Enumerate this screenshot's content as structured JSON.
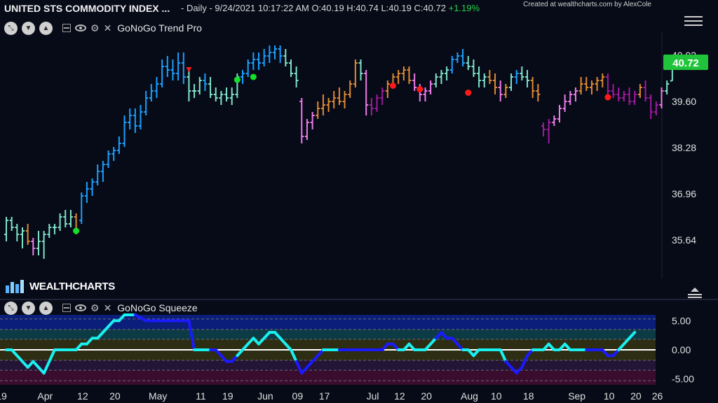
{
  "header": {
    "title": "UNITED STS COMMODITY INDEX ...",
    "info": "- Daily - 9/24/2021 10:17:22 AM O:40.19 H:40.74 L:40.19 C:40.72",
    "change": "+1.19%",
    "credit": "Created at wealthcharts.com by AlexCole"
  },
  "price_panel": {
    "indicator_label": "GoNoGo Trend Pro"
  },
  "squeeze_panel": {
    "indicator_label": "GoNoGo Squeeze"
  },
  "logo": {
    "text": "WEALTHCHARTS"
  },
  "colors": {
    "background": "#070b18",
    "go_strong": "#1aa0ff",
    "go_weak": "#7fe3c8",
    "nogo_weak": "#ee7ce8",
    "nogo_strong": "#a01a9e",
    "amber": "#e08a32",
    "dot_green": "#14e02a",
    "dot_red": "#ff1a1a",
    "squeeze_cyan": "#19f0f0",
    "squeeze_blue": "#1a1aff",
    "price_badge": "#20c43a"
  },
  "chart_data": [
    {
      "type": "bar",
      "title": "UNITED STS COMMODITY INDEX ...",
      "last_price_label": "40.72",
      "y_ticks": [
        35.64,
        36.96,
        38.28,
        39.6,
        40.92
      ],
      "y_tick_labels": [
        "35.64",
        "36.96",
        "38.28",
        "39.60",
        "40.92"
      ],
      "x_ticks": [
        {
          "i": -7,
          "label": "19"
        },
        {
          "i": 2,
          "label": "Apr"
        },
        {
          "i": 9,
          "label": "12"
        },
        {
          "i": 15,
          "label": "20"
        },
        {
          "i": 23,
          "label": "May"
        },
        {
          "i": 31,
          "label": "11"
        },
        {
          "i": 36,
          "label": "19"
        },
        {
          "i": 43,
          "label": "Jun"
        },
        {
          "i": 49,
          "label": "09"
        },
        {
          "i": 54,
          "label": "17"
        },
        {
          "i": 63,
          "label": "Jul"
        },
        {
          "i": 68,
          "label": "12"
        },
        {
          "i": 73,
          "label": "20"
        },
        {
          "i": 81,
          "label": "Aug"
        },
        {
          "i": 86,
          "label": "10"
        },
        {
          "i": 92,
          "label": "18"
        },
        {
          "i": 101,
          "label": "Sep"
        },
        {
          "i": 107,
          "label": "10"
        },
        {
          "i": 112,
          "label": "20"
        },
        {
          "i": 116,
          "label": "26"
        }
      ],
      "ylim": [
        34.6,
        41.6
      ],
      "ohlc": [
        [
          35.8,
          36.3,
          35.6,
          36.2,
          "gw"
        ],
        [
          36.2,
          36.3,
          35.9,
          36.0,
          "gw"
        ],
        [
          36.0,
          36.1,
          35.6,
          35.8,
          "gw"
        ],
        [
          35.8,
          36.0,
          35.4,
          35.9,
          "gw"
        ],
        [
          35.9,
          36.1,
          35.5,
          35.6,
          "am"
        ],
        [
          35.6,
          35.7,
          35.2,
          35.4,
          "nw"
        ],
        [
          35.4,
          35.9,
          35.2,
          35.6,
          "gw"
        ],
        [
          35.6,
          35.9,
          35.1,
          35.8,
          "gw"
        ],
        [
          35.8,
          36.1,
          35.7,
          36.0,
          "gw"
        ],
        [
          36.0,
          36.1,
          35.8,
          36.0,
          "gw"
        ],
        [
          36.0,
          36.4,
          35.9,
          36.3,
          "gw"
        ],
        [
          36.3,
          36.5,
          36.0,
          36.1,
          "gw"
        ],
        [
          36.1,
          36.5,
          36.0,
          36.3,
          "gw"
        ],
        [
          36.3,
          36.4,
          35.8,
          35.9,
          "am"
        ],
        [
          36.2,
          37.0,
          36.1,
          36.9,
          "gs"
        ],
        [
          36.9,
          37.3,
          36.7,
          37.1,
          "gs"
        ],
        [
          37.1,
          37.4,
          36.9,
          37.3,
          "gs"
        ],
        [
          37.3,
          37.8,
          37.2,
          37.6,
          "gs"
        ],
        [
          37.6,
          37.9,
          37.3,
          37.8,
          "gs"
        ],
        [
          37.8,
          38.2,
          37.7,
          38.1,
          "gs"
        ],
        [
          38.1,
          38.3,
          37.9,
          38.2,
          "gs"
        ],
        [
          38.2,
          38.6,
          38.1,
          38.4,
          "gs"
        ],
        [
          38.4,
          39.2,
          38.3,
          39.0,
          "gs"
        ],
        [
          39.0,
          39.4,
          38.8,
          39.2,
          "gs"
        ],
        [
          39.2,
          39.4,
          38.7,
          38.9,
          "gs"
        ],
        [
          38.9,
          39.5,
          38.8,
          39.3,
          "gs"
        ],
        [
          39.3,
          39.9,
          39.2,
          39.7,
          "gs"
        ],
        [
          39.7,
          40.1,
          39.6,
          39.9,
          "gs"
        ],
        [
          39.9,
          40.3,
          39.7,
          40.1,
          "gs"
        ],
        [
          40.1,
          40.8,
          40.0,
          40.6,
          "gs"
        ],
        [
          40.6,
          40.9,
          40.3,
          40.5,
          "gs"
        ],
        [
          40.5,
          40.8,
          40.2,
          40.4,
          "gs"
        ],
        [
          40.4,
          41.0,
          40.2,
          40.7,
          "gs"
        ],
        [
          40.7,
          41.0,
          40.1,
          40.3,
          "gs"
        ],
        [
          40.3,
          40.5,
          39.6,
          39.9,
          "gw"
        ],
        [
          39.9,
          40.1,
          39.7,
          39.9,
          "gw"
        ],
        [
          39.9,
          40.3,
          39.8,
          40.2,
          "gw"
        ],
        [
          40.2,
          40.4,
          39.9,
          40.1,
          "gs"
        ],
        [
          40.1,
          40.3,
          39.7,
          39.8,
          "gw"
        ],
        [
          39.8,
          40.0,
          39.6,
          39.7,
          "gw"
        ],
        [
          39.7,
          39.9,
          39.5,
          39.8,
          "gw"
        ],
        [
          39.8,
          40.0,
          39.6,
          39.7,
          "gw"
        ],
        [
          39.7,
          40.0,
          39.5,
          39.8,
          "gw"
        ],
        [
          39.8,
          40.4,
          39.7,
          40.3,
          "gw"
        ],
        [
          40.3,
          40.5,
          40.1,
          40.4,
          "gs"
        ],
        [
          40.4,
          40.8,
          40.3,
          40.7,
          "gs"
        ],
        [
          40.7,
          41.0,
          40.5,
          40.8,
          "gs"
        ],
        [
          40.8,
          41.0,
          40.5,
          40.7,
          "gs"
        ],
        [
          40.7,
          41.1,
          40.6,
          40.9,
          "gs"
        ],
        [
          40.9,
          41.2,
          40.7,
          41.0,
          "gs"
        ],
        [
          41.0,
          41.2,
          40.8,
          41.1,
          "gs"
        ],
        [
          41.1,
          41.2,
          40.7,
          40.9,
          "gs"
        ],
        [
          40.9,
          41.1,
          40.6,
          40.7,
          "gw"
        ],
        [
          40.7,
          40.8,
          40.3,
          40.4,
          "gw"
        ],
        [
          40.4,
          40.6,
          40.0,
          40.2,
          "gw"
        ],
        [
          39.6,
          39.7,
          38.4,
          38.6,
          "nw"
        ],
        [
          38.6,
          39.1,
          38.5,
          39.0,
          "nw"
        ],
        [
          39.0,
          39.3,
          38.8,
          39.2,
          "nw"
        ],
        [
          39.2,
          39.6,
          39.1,
          39.4,
          "am"
        ],
        [
          39.4,
          39.8,
          39.2,
          39.5,
          "am"
        ],
        [
          39.5,
          39.7,
          39.3,
          39.6,
          "am"
        ],
        [
          39.6,
          39.9,
          39.4,
          39.7,
          "am"
        ],
        [
          39.7,
          40.0,
          39.5,
          39.6,
          "am"
        ],
        [
          39.6,
          39.9,
          39.4,
          39.8,
          "am"
        ],
        [
          39.8,
          40.2,
          39.7,
          40.1,
          "am"
        ],
        [
          40.1,
          40.8,
          40.0,
          40.7,
          "am"
        ],
        [
          40.7,
          40.8,
          40.2,
          40.4,
          "gw"
        ],
        [
          40.4,
          40.5,
          39.2,
          39.5,
          "nw"
        ],
        [
          39.5,
          39.7,
          39.2,
          39.4,
          "ns"
        ],
        [
          39.4,
          39.8,
          39.3,
          39.7,
          "ns"
        ],
        [
          39.7,
          40.0,
          39.5,
          39.9,
          "ns"
        ],
        [
          39.9,
          40.2,
          39.7,
          40.1,
          "am"
        ],
        [
          40.1,
          40.4,
          40.0,
          40.3,
          "am"
        ],
        [
          40.3,
          40.5,
          40.1,
          40.4,
          "am"
        ],
        [
          40.4,
          40.6,
          40.2,
          40.5,
          "am"
        ],
        [
          40.5,
          40.6,
          40.1,
          40.2,
          "am"
        ],
        [
          40.2,
          40.4,
          39.9,
          40.0,
          "nw"
        ],
        [
          40.0,
          40.1,
          39.6,
          39.8,
          "nw"
        ],
        [
          39.8,
          40.0,
          39.6,
          39.9,
          "nw"
        ],
        [
          39.9,
          40.2,
          39.8,
          40.1,
          "nw"
        ],
        [
          40.1,
          40.4,
          40.0,
          40.3,
          "gw"
        ],
        [
          40.3,
          40.5,
          40.1,
          40.4,
          "gw"
        ],
        [
          40.4,
          40.6,
          40.2,
          40.5,
          "gw"
        ],
        [
          40.5,
          40.9,
          40.4,
          40.8,
          "gs"
        ],
        [
          40.8,
          41.0,
          40.7,
          40.9,
          "gs"
        ],
        [
          40.9,
          41.1,
          40.6,
          40.7,
          "gs"
        ],
        [
          40.7,
          40.9,
          40.5,
          40.6,
          "gw"
        ],
        [
          40.6,
          40.8,
          40.3,
          40.4,
          "gw"
        ],
        [
          40.4,
          40.6,
          40.0,
          40.2,
          "gw"
        ],
        [
          40.2,
          40.4,
          40.0,
          40.3,
          "gw"
        ],
        [
          40.3,
          40.5,
          40.1,
          40.2,
          "am"
        ],
        [
          40.2,
          40.4,
          39.8,
          40.0,
          "am"
        ],
        [
          40.0,
          40.2,
          39.6,
          39.8,
          "nw"
        ],
        [
          39.8,
          40.1,
          39.7,
          40.0,
          "am"
        ],
        [
          40.0,
          40.4,
          39.9,
          40.3,
          "gw"
        ],
        [
          40.3,
          40.5,
          40.1,
          40.4,
          "gs"
        ],
        [
          40.4,
          40.6,
          40.2,
          40.3,
          "gw"
        ],
        [
          40.3,
          40.5,
          40.0,
          40.2,
          "gw"
        ],
        [
          40.2,
          40.3,
          39.7,
          39.9,
          "am"
        ],
        [
          39.9,
          40.1,
          39.6,
          39.8,
          "am"
        ],
        [
          38.9,
          39.0,
          38.6,
          38.8,
          "ns"
        ],
        [
          38.8,
          39.1,
          38.4,
          39.0,
          "ns"
        ],
        [
          39.0,
          39.2,
          38.9,
          39.1,
          "nw"
        ],
        [
          39.1,
          39.5,
          39.0,
          39.4,
          "nw"
        ],
        [
          39.4,
          39.8,
          39.3,
          39.6,
          "nw"
        ],
        [
          39.6,
          39.9,
          39.5,
          39.8,
          "nw"
        ],
        [
          39.8,
          40.0,
          39.6,
          39.9,
          "nw"
        ],
        [
          39.9,
          40.3,
          39.8,
          40.1,
          "am"
        ],
        [
          40.1,
          40.3,
          39.9,
          40.0,
          "am"
        ],
        [
          40.0,
          40.2,
          39.8,
          40.1,
          "am"
        ],
        [
          40.1,
          40.3,
          39.9,
          40.2,
          "am"
        ],
        [
          40.2,
          40.4,
          40.0,
          40.3,
          "am"
        ],
        [
          40.3,
          40.4,
          39.8,
          39.9,
          "ns"
        ],
        [
          39.9,
          40.1,
          39.7,
          39.8,
          "ns"
        ],
        [
          39.8,
          40.0,
          39.6,
          39.7,
          "ns"
        ],
        [
          39.7,
          39.9,
          39.6,
          39.8,
          "ns"
        ],
        [
          39.8,
          40.0,
          39.5,
          39.6,
          "ns"
        ],
        [
          39.6,
          39.9,
          39.5,
          39.8,
          "ns"
        ],
        [
          39.8,
          40.1,
          39.7,
          40.0,
          "am"
        ],
        [
          40.0,
          40.2,
          39.6,
          39.7,
          "ns"
        ],
        [
          39.7,
          39.8,
          39.1,
          39.3,
          "ns"
        ],
        [
          39.3,
          39.6,
          39.2,
          39.5,
          "ns"
        ],
        [
          39.5,
          40.0,
          39.4,
          39.9,
          "nw"
        ],
        [
          39.9,
          40.2,
          39.8,
          40.1,
          "gw"
        ],
        [
          40.19,
          40.74,
          40.19,
          40.72,
          "gw"
        ]
      ],
      "dots": [
        {
          "i": 13,
          "y": 35.9,
          "color": "dot_green"
        },
        {
          "i": 43,
          "y": 40.22,
          "color": "dot_green"
        },
        {
          "i": 46,
          "y": 40.3,
          "color": "dot_green"
        },
        {
          "i": 72,
          "y": 40.05,
          "color": "dot_red"
        },
        {
          "i": 77,
          "y": 39.95,
          "color": "dot_red"
        },
        {
          "i": 86,
          "y": 39.85,
          "color": "dot_red"
        },
        {
          "i": 112,
          "y": 39.72,
          "color": "dot_red"
        }
      ],
      "triangles": [
        {
          "i": 34,
          "y": 40.5,
          "color": "dot_red"
        }
      ]
    },
    {
      "type": "line",
      "title": "GoNoGo Squeeze",
      "y_ticks": [
        5,
        0,
        -5
      ],
      "y_tick_labels": [
        "5.00",
        "0.00",
        "-5.00"
      ],
      "ylim": [
        -6,
        6
      ],
      "values": [
        0,
        0,
        -1,
        -2,
        -3,
        -2,
        -3,
        -4,
        -2,
        0,
        0,
        0,
        0,
        0,
        1,
        1,
        2,
        2,
        3,
        4,
        5,
        5,
        6,
        6,
        6,
        5.5,
        5,
        5,
        5,
        5,
        5,
        5,
        5,
        5,
        5,
        0,
        0,
        0,
        0,
        0,
        -1,
        -2,
        -2,
        -1,
        0,
        1,
        2,
        1,
        2,
        3,
        3,
        2,
        1,
        0,
        -2,
        -4,
        -3,
        -2,
        -1,
        0,
        0,
        0,
        0,
        0,
        0,
        0,
        0,
        0,
        0,
        0,
        0,
        1,
        1,
        0,
        0,
        1,
        0,
        0,
        0,
        1,
        2,
        3,
        2,
        2,
        1,
        0,
        0,
        -1,
        0,
        0,
        0,
        0,
        0,
        -2,
        -3,
        -4,
        -3,
        -1,
        0,
        0,
        0,
        1,
        0,
        0,
        1,
        0,
        0,
        0,
        0,
        0,
        0,
        0,
        -1,
        -1,
        0,
        1,
        2,
        3
      ]
    }
  ]
}
